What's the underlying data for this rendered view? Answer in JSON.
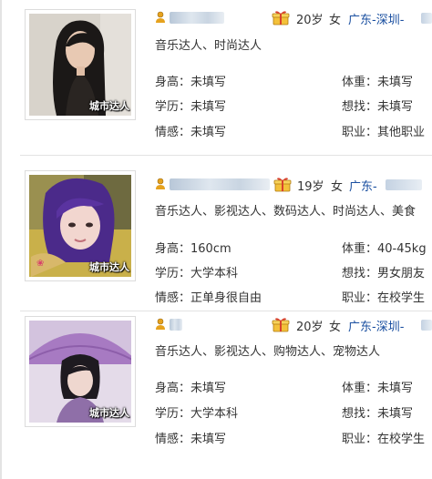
{
  "profiles": [
    {
      "badge": "城市达人",
      "age": "20岁",
      "gender": "女",
      "location": "广东-深圳-",
      "tags": "音乐达人、时尚达人",
      "height": {
        "label": "身高：",
        "value": "未填写"
      },
      "weight": {
        "label": "体重：",
        "value": "未填写"
      },
      "education": {
        "label": "学历：",
        "value": "未填写"
      },
      "seeking": {
        "label": "想找：",
        "value": "未填写"
      },
      "relationship": {
        "label": "情感：",
        "value": "未填写"
      },
      "occupation": {
        "label": "职业：",
        "value": "其他职业"
      }
    },
    {
      "badge": "城市达人",
      "age": "19岁",
      "gender": "女",
      "location": "广东-",
      "tags": "音乐达人、影视达人、数码达人、时尚达人、美食",
      "height": {
        "label": "身高：",
        "value": "160cm"
      },
      "weight": {
        "label": "体重：",
        "value": "40-45kg"
      },
      "education": {
        "label": "学历：",
        "value": "大学本科"
      },
      "seeking": {
        "label": "想找：",
        "value": "男女朋友"
      },
      "relationship": {
        "label": "情感：",
        "value": "正单身很自由"
      },
      "occupation": {
        "label": "职业：",
        "value": "在校学生"
      }
    },
    {
      "badge": "城市达人",
      "age": "20岁",
      "gender": "女",
      "location": "广东-深圳-",
      "tags": "音乐达人、影视达人、购物达人、宠物达人",
      "height": {
        "label": "身高：",
        "value": "未填写"
      },
      "weight": {
        "label": "体重：",
        "value": "未填写"
      },
      "education": {
        "label": "学历：",
        "value": "大学本科"
      },
      "seeking": {
        "label": "想找：",
        "value": "未填写"
      },
      "relationship": {
        "label": "情感：",
        "value": "未填写"
      },
      "occupation": {
        "label": "职业：",
        "value": "在校学生"
      }
    }
  ],
  "icons": {
    "user": "user-icon",
    "gift": "gift-icon"
  },
  "colors": {
    "location_link": "#1a4fa0",
    "text": "#333333",
    "separator": "#e2e2e2"
  }
}
